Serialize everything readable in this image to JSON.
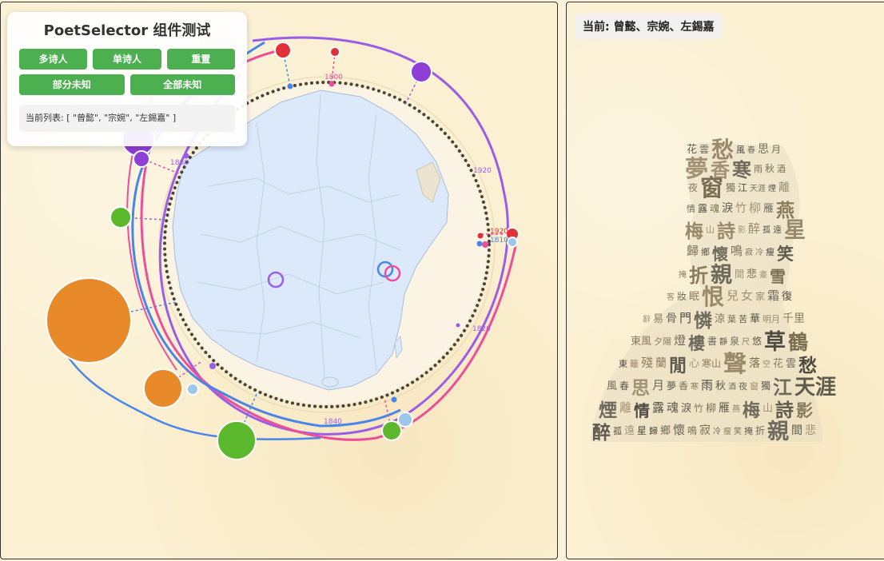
{
  "controls": {
    "title": "PoetSelector 组件测试",
    "buttons": [
      "多诗人",
      "单诗人",
      "重置",
      "部分未知",
      "全部未知"
    ],
    "list_text": "当前列表: [ \"曾懿\", \"宗婉\", \"左錫嘉\" ]"
  },
  "year_labels": [
    "1800",
    "1820",
    "1840",
    "1880",
    "1920",
    "1920",
    "1810"
  ],
  "right": {
    "current": "当前: 曾懿、宗婉、左錫嘉"
  },
  "colors": {
    "blue": "#4a86e8",
    "purple": "#9b5de5",
    "pink": "#ec4f9a",
    "orange": "#e8892a",
    "green": "#5cb82c",
    "red": "#e0303a",
    "map_fill": "#dbe9fb",
    "map_border": "#a9bdd8"
  },
  "word_cloud": {
    "words": [
      "花",
      "雲",
      "愁",
      "風",
      "春",
      "思",
      "月",
      "夢",
      "香",
      "寒",
      "雨",
      "秋",
      "酒",
      "夜",
      "窗",
      "獨",
      "江",
      "天涯",
      "煙",
      "離",
      "情",
      "露",
      "魂",
      "淚",
      "竹",
      "柳",
      "雁",
      "燕",
      "梅",
      "山",
      "詩",
      "影",
      "醉",
      "孤",
      "遠",
      "星",
      "歸",
      "鄉",
      "懷",
      "鳴",
      "寂",
      "冷",
      "瘦",
      "笑",
      "掩",
      "折",
      "親",
      "間",
      "悲",
      "畫",
      "雪",
      "客",
      "妝",
      "眠",
      "恨",
      "兒",
      "女",
      "家",
      "霜",
      "復",
      "辭",
      "易",
      "骨",
      "門",
      "憐",
      "涼",
      "葉",
      "苦",
      "華",
      "明月",
      "千里",
      "東風",
      "夕陽",
      "燈",
      "樓",
      "書",
      "靜",
      "泉",
      "尺",
      "悠",
      "草",
      "鶴",
      "東",
      "籬",
      "殘",
      "蘭",
      "閒",
      "心",
      "寒山",
      "聲",
      "落",
      "空"
    ]
  }
}
